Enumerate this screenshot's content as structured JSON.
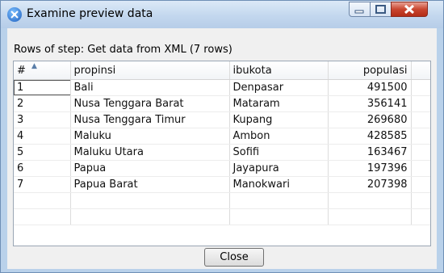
{
  "window": {
    "title": "Examine preview data"
  },
  "caption": "Rows of step: Get data from XML (7 rows)",
  "table": {
    "headers": [
      "#",
      "propinsi",
      "ibukota",
      "populasi"
    ],
    "rows": [
      [
        "1",
        "Bali",
        "Denpasar",
        "491500"
      ],
      [
        "2",
        "Nusa Tenggara Barat",
        "Mataram",
        "356141"
      ],
      [
        "3",
        "Nusa Tenggara Timur",
        "Kupang",
        "269680"
      ],
      [
        "4",
        "Maluku",
        "Ambon",
        "428585"
      ],
      [
        "5",
        "Maluku Utara",
        "Sofifi",
        "163467"
      ],
      [
        "6",
        "Papua",
        "Jayapura",
        "197396"
      ],
      [
        "7",
        "Papua Barat",
        "Manokwari",
        "207398"
      ]
    ]
  },
  "footer": {
    "close_label": "Close"
  },
  "colors": {
    "titlebar": "#c3d7ee",
    "close_red": "#c9462f"
  },
  "icons": [
    "app-icon",
    "minimize-icon",
    "maximize-icon",
    "close-icon",
    "sort-ascending-icon"
  ]
}
